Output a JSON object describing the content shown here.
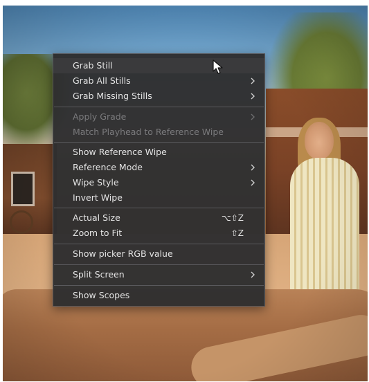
{
  "menu": {
    "items": [
      {
        "label": "Grab Still",
        "shortcut": "",
        "submenu": false,
        "enabled": true
      },
      {
        "label": "Grab All Stills",
        "shortcut": "",
        "submenu": true,
        "enabled": true
      },
      {
        "label": "Grab Missing Stills",
        "shortcut": "",
        "submenu": true,
        "enabled": true
      },
      {
        "label": "Apply Grade",
        "shortcut": "",
        "submenu": true,
        "enabled": false
      },
      {
        "label": "Match Playhead to Reference Wipe",
        "shortcut": "",
        "submenu": false,
        "enabled": false
      },
      {
        "label": "Show Reference Wipe",
        "shortcut": "",
        "submenu": false,
        "enabled": true
      },
      {
        "label": "Reference Mode",
        "shortcut": "",
        "submenu": true,
        "enabled": true
      },
      {
        "label": "Wipe Style",
        "shortcut": "",
        "submenu": true,
        "enabled": true
      },
      {
        "label": "Invert Wipe",
        "shortcut": "",
        "submenu": false,
        "enabled": true
      },
      {
        "label": "Actual Size",
        "shortcut": "⌥⇧Z",
        "submenu": false,
        "enabled": true
      },
      {
        "label": "Zoom to Fit",
        "shortcut": "⇧Z",
        "submenu": false,
        "enabled": true
      },
      {
        "label": "Show picker RGB value",
        "shortcut": "",
        "submenu": false,
        "enabled": true
      },
      {
        "label": "Split Screen",
        "shortcut": "",
        "submenu": true,
        "enabled": true
      },
      {
        "label": "Show Scopes",
        "shortcut": "",
        "submenu": false,
        "enabled": true
      }
    ]
  },
  "colors": {
    "menu_bg": "#2e2e30",
    "menu_text": "#e3e3e3",
    "menu_text_disabled": "#7a7a7c",
    "highlight": "#3a3a3c"
  },
  "icons": {
    "submenu": "chevron-right-icon",
    "cursor": "mouse-pointer-icon"
  }
}
